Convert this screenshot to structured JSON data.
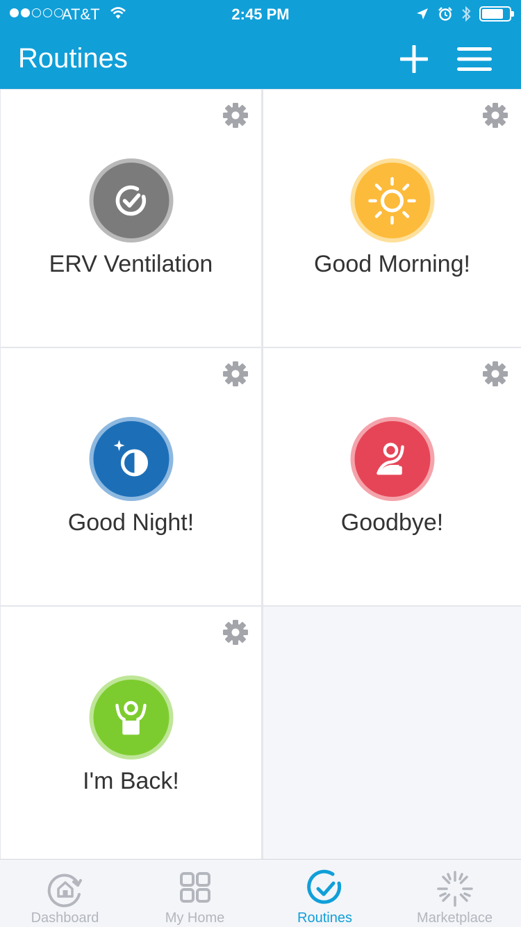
{
  "status_bar": {
    "carrier": "AT&T",
    "time": "2:45 PM"
  },
  "header": {
    "title": "Routines",
    "add_icon": "plus-icon",
    "menu_icon": "hamburger-menu-icon"
  },
  "routines": [
    {
      "name": "ERV Ventilation",
      "icon": "check-circle-icon",
      "color": "#7b7b7b",
      "ring": "#b9b9b9"
    },
    {
      "name": "Good Morning!",
      "icon": "sun-icon",
      "color": "#fdbb3b",
      "ring": "#fde09c"
    },
    {
      "name": "Good Night!",
      "icon": "moon-icon",
      "color": "#1c6fb7",
      "ring": "#8db8e0"
    },
    {
      "name": "Goodbye!",
      "icon": "waving-person-icon",
      "color": "#e64557",
      "ring": "#f4a3ab"
    },
    {
      "name": "I'm Back!",
      "icon": "arms-up-person-icon",
      "color": "#7dcc2f",
      "ring": "#bfe698"
    }
  ],
  "tabs": [
    {
      "label": "Dashboard",
      "icon": "dashboard-home-icon",
      "active": false
    },
    {
      "label": "My Home",
      "icon": "grid-icon",
      "active": false
    },
    {
      "label": "Routines",
      "icon": "routines-check-icon",
      "active": true
    },
    {
      "label": "Marketplace",
      "icon": "marketplace-burst-icon",
      "active": false
    }
  ],
  "colors": {
    "brand": "#119fd8",
    "gear": "#a3a5ab",
    "tab_inactive": "#b3b6bd"
  }
}
